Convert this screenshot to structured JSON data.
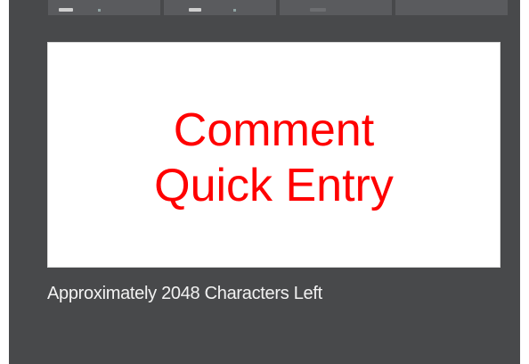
{
  "comment_entry": {
    "placeholder_line1": "Comment",
    "placeholder_line2": "Quick Entry",
    "placeholder_color": "#ff0000",
    "counter_text": "Approximately 2048 Characters Left"
  },
  "colors": {
    "panel_background": "#48494b",
    "tab_background": "#5a5b5e",
    "text_area_background": "#ffffff",
    "counter_text_color": "#f2f2f2"
  }
}
